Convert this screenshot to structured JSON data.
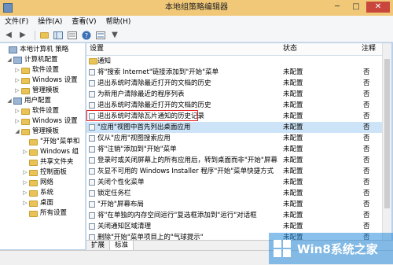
{
  "window": {
    "title": "本地组策略编辑器",
    "minimize": "─",
    "maximize": "□",
    "close": "✕"
  },
  "menu": [
    "文件(F)",
    "操作(A)",
    "查看(V)",
    "帮助(H)"
  ],
  "toolbar": {
    "back": "◀",
    "forward": "▶",
    "filter": "▼"
  },
  "tree": [
    {
      "label": "本地计算机 策略",
      "indent": 0,
      "twisty": "",
      "icon": "pc"
    },
    {
      "label": "计算机配置",
      "indent": 1,
      "twisty": "◢",
      "icon": "pc"
    },
    {
      "label": "软件设置",
      "indent": 2,
      "twisty": "▷",
      "icon": "folder"
    },
    {
      "label": "Windows 设置",
      "indent": 2,
      "twisty": "▷",
      "icon": "folder"
    },
    {
      "label": "管理模板",
      "indent": 2,
      "twisty": "▷",
      "icon": "folder"
    },
    {
      "label": "用户配置",
      "indent": 1,
      "twisty": "◢",
      "icon": "pc"
    },
    {
      "label": "软件设置",
      "indent": 2,
      "twisty": "▷",
      "icon": "folder"
    },
    {
      "label": "Windows 设置",
      "indent": 2,
      "twisty": "▷",
      "icon": "folder"
    },
    {
      "label": "管理模板",
      "indent": 2,
      "twisty": "◢",
      "icon": "folder"
    },
    {
      "label": "\"开始\"菜单和",
      "indent": 3,
      "twisty": "",
      "icon": "folder"
    },
    {
      "label": "Windows 组",
      "indent": 3,
      "twisty": "▷",
      "icon": "folder"
    },
    {
      "label": "共享文件夹",
      "indent": 3,
      "twisty": "",
      "icon": "folder"
    },
    {
      "label": "控制面板",
      "indent": 3,
      "twisty": "▷",
      "icon": "folder"
    },
    {
      "label": "网络",
      "indent": 3,
      "twisty": "▷",
      "icon": "folder"
    },
    {
      "label": "系统",
      "indent": 3,
      "twisty": "▷",
      "icon": "folder"
    },
    {
      "label": "桌面",
      "indent": 3,
      "twisty": "▷",
      "icon": "folder"
    },
    {
      "label": "所有设置",
      "indent": 3,
      "twisty": "",
      "icon": "folder"
    }
  ],
  "table": {
    "headers": {
      "name": "设置",
      "state": "状态",
      "comment": "注释"
    },
    "rows": [
      {
        "name": "通知",
        "state": "",
        "comment": "",
        "folder": true
      },
      {
        "name": "将\"搜索 Internet\"链接添加到\"开始\"菜单",
        "state": "未配置",
        "comment": "否"
      },
      {
        "name": "退出系统时清除最近打开的文档的历史",
        "state": "未配置",
        "comment": "否"
      },
      {
        "name": "为新用户清除最近的程序列表",
        "state": "未配置",
        "comment": "否"
      },
      {
        "name": "退出系统时清除最近打开的文档的历史",
        "state": "未配置",
        "comment": "否"
      },
      {
        "name": "退出系统时清除瓦片通知的历史记录",
        "state": "未配置",
        "comment": "否"
      },
      {
        "name": "\"应用\"视图中首先列出桌面应用",
        "state": "未配置",
        "comment": "否",
        "selected": true
      },
      {
        "name": "仅从\"应用\"视图搜索应用",
        "state": "未配置",
        "comment": "否"
      },
      {
        "name": "将\"注销\"添加到\"开始\"菜单",
        "state": "未配置",
        "comment": "否"
      },
      {
        "name": "登录时或关闭屏幕上的所有应用后，转到桌面而非\"开始\"屏幕",
        "state": "未配置",
        "comment": "否"
      },
      {
        "name": "灰显不可用的 Windows Installer 程序\"开始\"菜单快捷方式",
        "state": "未配置",
        "comment": "否"
      },
      {
        "name": "关闭个性化菜单",
        "state": "未配置",
        "comment": "否"
      },
      {
        "name": "锁定任务栏",
        "state": "未配置",
        "comment": "否"
      },
      {
        "name": "\"开始\"屏幕布局",
        "state": "未配置",
        "comment": "否"
      },
      {
        "name": "将\"在单独的内存空间运行\"复选框添加到\"运行\"对话框",
        "state": "未配置",
        "comment": "否"
      },
      {
        "name": "关闭通知区域清理",
        "state": "未配置",
        "comment": "否"
      },
      {
        "name": "删除\"开始\"菜单项目上的\"气球提示\"",
        "state": "未配置",
        "comment": "否"
      }
    ]
  },
  "tabs": [
    "扩展",
    "标准"
  ],
  "watermark": {
    "text": "Win8系统之家"
  }
}
